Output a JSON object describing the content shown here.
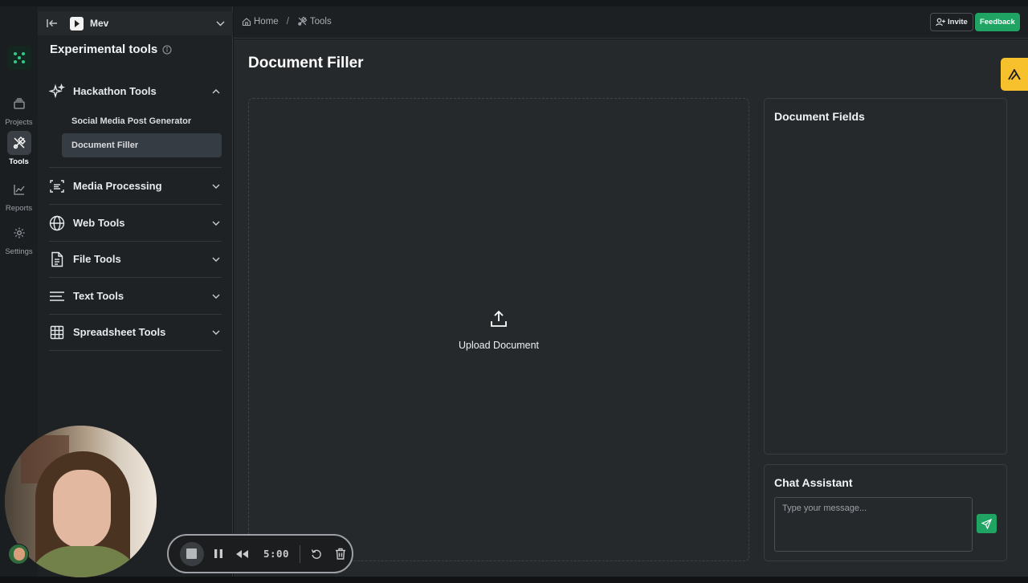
{
  "rail": {
    "items": [
      {
        "label": "Projects",
        "icon": "layers-icon"
      },
      {
        "label": "Tools",
        "icon": "tools-icon",
        "active": true
      },
      {
        "label": "Reports",
        "icon": "chart-icon"
      },
      {
        "label": "Settings",
        "icon": "gear-icon"
      }
    ]
  },
  "sidebar": {
    "workspace": "Mev",
    "title": "Experimental tools",
    "groups": [
      {
        "label": "Hackathon Tools",
        "icon": "sparkles-icon",
        "expanded": true,
        "items": [
          {
            "label": "Social Media Post Generator"
          },
          {
            "label": "Document Filler",
            "active": true
          }
        ]
      },
      {
        "label": "Media Processing",
        "icon": "scan-text-icon"
      },
      {
        "label": "Web Tools",
        "icon": "globe-icon"
      },
      {
        "label": "File Tools",
        "icon": "file-icon"
      },
      {
        "label": "Text Tools",
        "icon": "text-lines-icon"
      },
      {
        "label": "Spreadsheet Tools",
        "icon": "table-icon"
      }
    ]
  },
  "header": {
    "breadcrumb": [
      {
        "label": "Home",
        "icon": "home-icon"
      },
      {
        "label": "Tools",
        "icon": "tools-icon"
      }
    ],
    "breadcrumb_separator": "/",
    "invite_label": "Invite",
    "feedback_label": "Feedback"
  },
  "main": {
    "title": "Document Filler",
    "upload_label": "Upload Document",
    "fields_panel_title": "Document Fields",
    "chat_panel_title": "Chat Assistant",
    "chat_placeholder": "Type your message..."
  },
  "recorder": {
    "time": "5:00"
  },
  "colors": {
    "accent_green": "#1fa463",
    "background": "#25292c",
    "sidebar": "#1f2225",
    "yellow_tab": "#f6c12c"
  }
}
